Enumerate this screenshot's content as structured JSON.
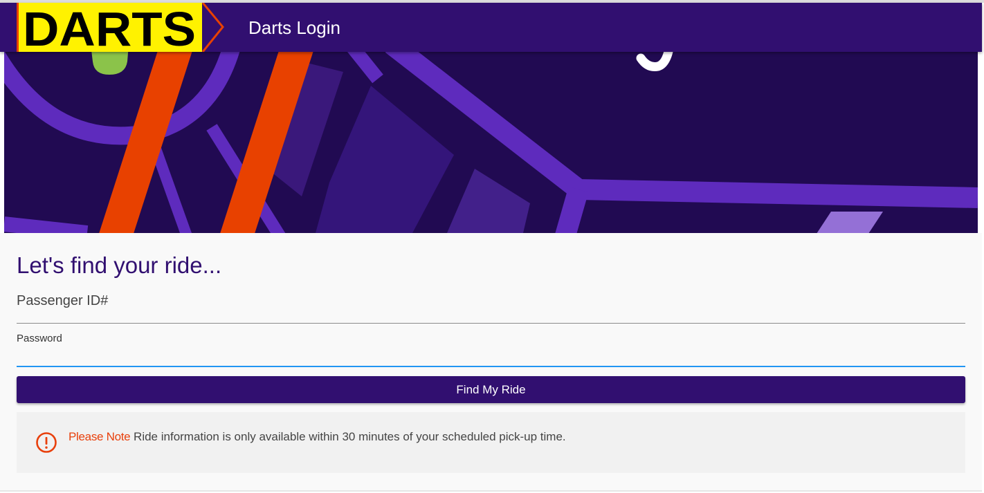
{
  "appbar": {
    "logo_text": "DARTS",
    "title": "Darts Login"
  },
  "login": {
    "heading": "Let's find your ride...",
    "passenger_id_label": "Passenger ID#",
    "passenger_id_value": "",
    "password_label": "Password",
    "password_value": "",
    "submit_label": "Find My Ride"
  },
  "notice": {
    "icon": "alert-circle-icon",
    "strong": "Please Note",
    "text": "Ride information is only available within 30 minutes of your scheduled pick-up time."
  },
  "colors": {
    "brand_purple": "#310f70",
    "hero_dark": "#210a52",
    "route_purple": "#5e2bbd",
    "route_orange": "#e84100",
    "logo_yellow": "#fff200",
    "note_accent": "#e8400c",
    "focus_blue": "#2196f3"
  }
}
